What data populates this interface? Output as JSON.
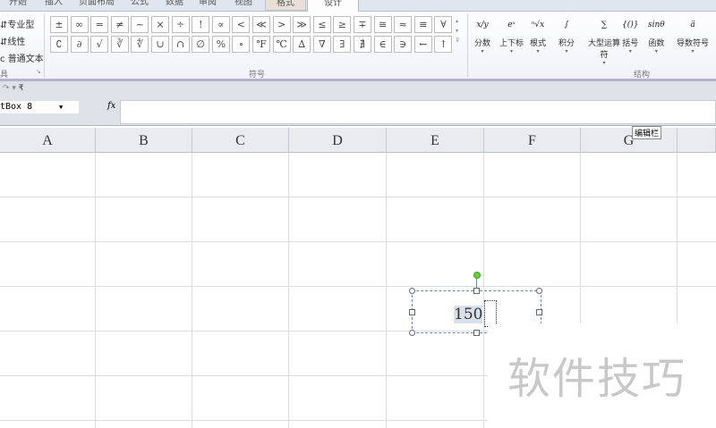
{
  "tabs": [
    "开始",
    "插入",
    "页面布局",
    "公式",
    "数据",
    "审阅",
    "视图",
    "格式",
    "设计"
  ],
  "active_tab": "设计",
  "tools_group": {
    "items": [
      "专业型",
      "线性",
      "普通文本"
    ],
    "label": "具"
  },
  "symbols_group": {
    "label": "符号",
    "row1": [
      "±",
      "∞",
      "=",
      "≠",
      "~",
      "×",
      "÷",
      "!",
      "∝",
      "<",
      "≪",
      ">",
      "≫",
      "≤",
      "≥",
      "∓",
      "≅",
      "≈",
      "≡",
      "∀"
    ],
    "row2": [
      "∁",
      "∂",
      "√",
      "∛",
      "∜",
      "∪",
      "∩",
      "∅",
      "%",
      "∘",
      "℉",
      "℃",
      "∆",
      "∇",
      "∃",
      "∄",
      "∈",
      "∋",
      "←",
      "↑"
    ]
  },
  "structures_group": {
    "label": "结构",
    "items": [
      {
        "glyph": "x/y",
        "label": "分数"
      },
      {
        "glyph": "eˣ",
        "label": "上下标"
      },
      {
        "glyph": "ⁿ√x",
        "label": "根式"
      },
      {
        "glyph": "∫",
        "label": "积分"
      },
      {
        "glyph": "∑",
        "label": "大型运算符"
      },
      {
        "glyph": "{()}",
        "label": "括号"
      },
      {
        "glyph": "sinθ",
        "label": "函数"
      },
      {
        "glyph": "ä",
        "label": "导数符号"
      }
    ]
  },
  "name_box": "tBox 8",
  "fx_label": "fx",
  "tooltip": "编辑栏",
  "columns": [
    "A",
    "B",
    "C",
    "D",
    "E",
    "F",
    "G"
  ],
  "textbox": {
    "value": "150"
  },
  "watermark": "软件技巧"
}
